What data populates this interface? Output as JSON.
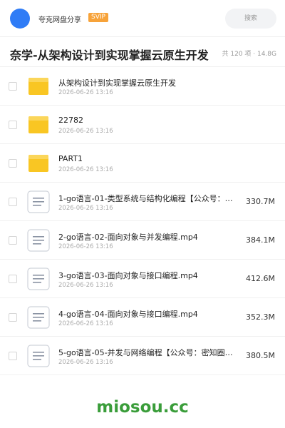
{
  "header": {
    "share_name": "夸克网盘分享",
    "badge": "SVIP",
    "search_label": "搜索"
  },
  "page": {
    "title": "奈学-从架构设计到实现掌握云原生开发",
    "summary": "共 120 项 · 14.8G"
  },
  "items": [
    {
      "type": "folder",
      "name": "从架构设计到实现掌握云原生开发",
      "date": "2026-06-26 13:16",
      "size": ""
    },
    {
      "type": "folder",
      "name": "22782",
      "date": "2026-06-26 13:16",
      "size": ""
    },
    {
      "type": "folder",
      "name": "PART1",
      "date": "2026-06-26 13:16",
      "size": ""
    },
    {
      "type": "file",
      "name": "1-go语言-01-类型系统与结构化编程【公众号：…",
      "date": "2026-06-26 13:16",
      "size": "330.7M"
    },
    {
      "type": "file",
      "name": "2-go语言-02-面向对象与并发编程.mp4",
      "date": "2026-06-26 13:16",
      "size": "384.1M"
    },
    {
      "type": "file",
      "name": "3-go语言-03-面向对象与接口编程.mp4",
      "date": "2026-06-26 13:16",
      "size": "412.6M"
    },
    {
      "type": "file",
      "name": "4-go语言-04-面向对象与接口编程.mp4",
      "date": "2026-06-26 13:16",
      "size": "352.3M"
    },
    {
      "type": "file",
      "name": "5-go语言-05-并发与网络编程【公众号：密知圈…",
      "date": "2026-06-26 13:16",
      "size": "380.5M"
    }
  ],
  "watermark": "miosou.cc",
  "colors": {
    "accent": "#2f7cf6",
    "badge": "#f7a33a",
    "folder": "#f9c623",
    "watermark": "#3a9d3a"
  }
}
